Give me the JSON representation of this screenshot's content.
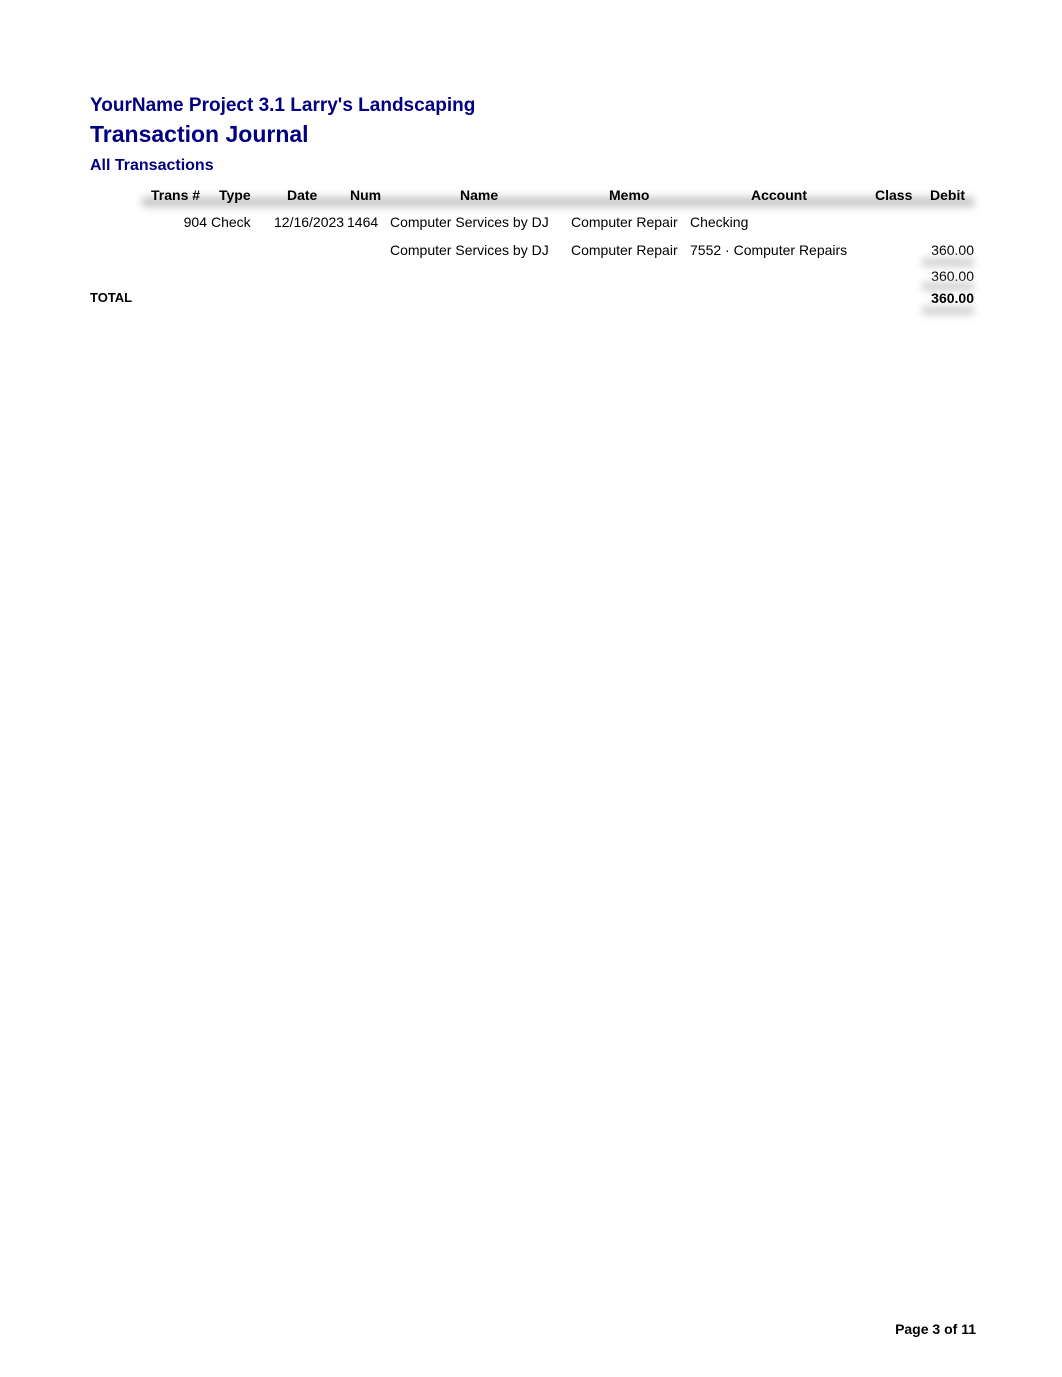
{
  "report": {
    "company_title": "YourName Project 3.1 Larry's Landscaping",
    "report_title": "Transaction Journal",
    "subtitle": "All Transactions"
  },
  "table": {
    "columns": [
      "Trans #",
      "Type",
      "Date",
      "Num",
      "Name",
      "Memo",
      "Account",
      "Class",
      "Debit"
    ],
    "rows": [
      {
        "trans_no": "904",
        "type": "Check",
        "date": "12/16/2023",
        "num": "1464",
        "name": "Computer Services by DJ",
        "memo": "Computer Repair",
        "account": "Checking",
        "class": "",
        "debit": ""
      },
      {
        "trans_no": "",
        "type": "",
        "date": "",
        "num": "",
        "name": "Computer Services by DJ",
        "memo": "Computer Repair",
        "account": "7552 · Computer Repairs",
        "class": "",
        "debit": "360.00"
      }
    ],
    "subtotal_debit": "360.00",
    "total_label": "TOTAL",
    "total_debit": "360.00"
  },
  "footer": {
    "page_label": "Page 3 of 11"
  }
}
